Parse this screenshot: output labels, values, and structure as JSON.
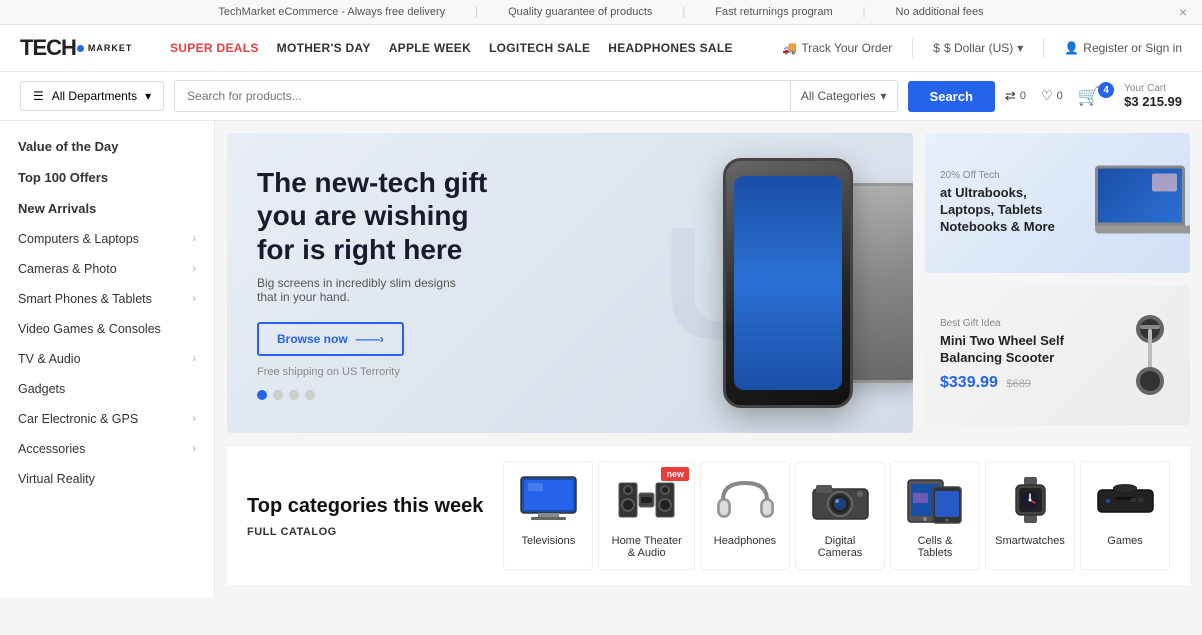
{
  "announcement_bar": {
    "items": [
      "TechMarket eCommerce - Always free delivery",
      "Quality guarantee of products",
      "Fast returnings program",
      "No additional fees"
    ],
    "close_label": "×"
  },
  "header": {
    "logo": {
      "tech": "TECH",
      "market": "MARKET"
    },
    "nav": [
      {
        "label": "SUPER DEALS",
        "class": "super-deals"
      },
      {
        "label": "MOTHER'S DAY"
      },
      {
        "label": "APPLE WEEK"
      },
      {
        "label": "LOGITECH SALE"
      },
      {
        "label": "HEADPHONES SALE"
      }
    ],
    "track_order": "Track Your Order",
    "currency": "$ Dollar (US)",
    "register": "Register or Sign in"
  },
  "search_bar": {
    "departments_label": "All Departments",
    "search_placeholder": "Search for products...",
    "categories_label": "All Categories",
    "search_button": "Search",
    "compare_count": "0",
    "wishlist_count": "0",
    "cart_count": "4",
    "cart_label": "Your Cart",
    "cart_amount": "$3 215.99"
  },
  "sidebar": {
    "items": [
      {
        "label": "Value of the Day",
        "bold": true,
        "has_arrow": false
      },
      {
        "label": "Top 100 Offers",
        "bold": true,
        "has_arrow": false
      },
      {
        "label": "New Arrivals",
        "bold": true,
        "has_arrow": false
      },
      {
        "label": "Computers & Laptops",
        "has_arrow": true
      },
      {
        "label": "Cameras & Photo",
        "has_arrow": true
      },
      {
        "label": "Smart Phones & Tablets",
        "has_arrow": true
      },
      {
        "label": "Video Games & Consoles",
        "has_arrow": false
      },
      {
        "label": "TV & Audio",
        "has_arrow": true
      },
      {
        "label": "Gadgets",
        "has_arrow": false
      },
      {
        "label": "Car Electronic & GPS",
        "has_arrow": true
      },
      {
        "label": "Accessories",
        "has_arrow": true
      },
      {
        "label": "Virtual Reality",
        "has_arrow": false
      }
    ]
  },
  "main_banner": {
    "headline": "The new-tech gift you are wishing for is right here",
    "sub": "Big screens in incredibly slim designs that in your hand.",
    "btn_label": "Browse now",
    "shipping": "Free shipping on US Terrority",
    "bg_text": "UK"
  },
  "side_banner_1": {
    "label": "20% Off Tech",
    "title": "at Ultrabooks, Laptops, Tablets Notebooks & More"
  },
  "side_banner_2": {
    "label": "Best Gift Idea",
    "title": "Mini Two Wheel Self Balancing Scooter",
    "price": "$339.99",
    "old_price": "$689"
  },
  "bottom_section": {
    "title": "Top categories this week",
    "full_catalog": "FULL CATALOG",
    "categories": [
      {
        "name": "Televisions",
        "new": false
      },
      {
        "name": "Home Theater & Audio",
        "new": true
      },
      {
        "name": "Headphones",
        "new": false
      },
      {
        "name": "Digital Cameras",
        "new": false
      },
      {
        "name": "Cells & Tablets",
        "new": false
      },
      {
        "name": "Smartwatches",
        "new": false
      },
      {
        "name": "Games",
        "new": false
      }
    ]
  }
}
